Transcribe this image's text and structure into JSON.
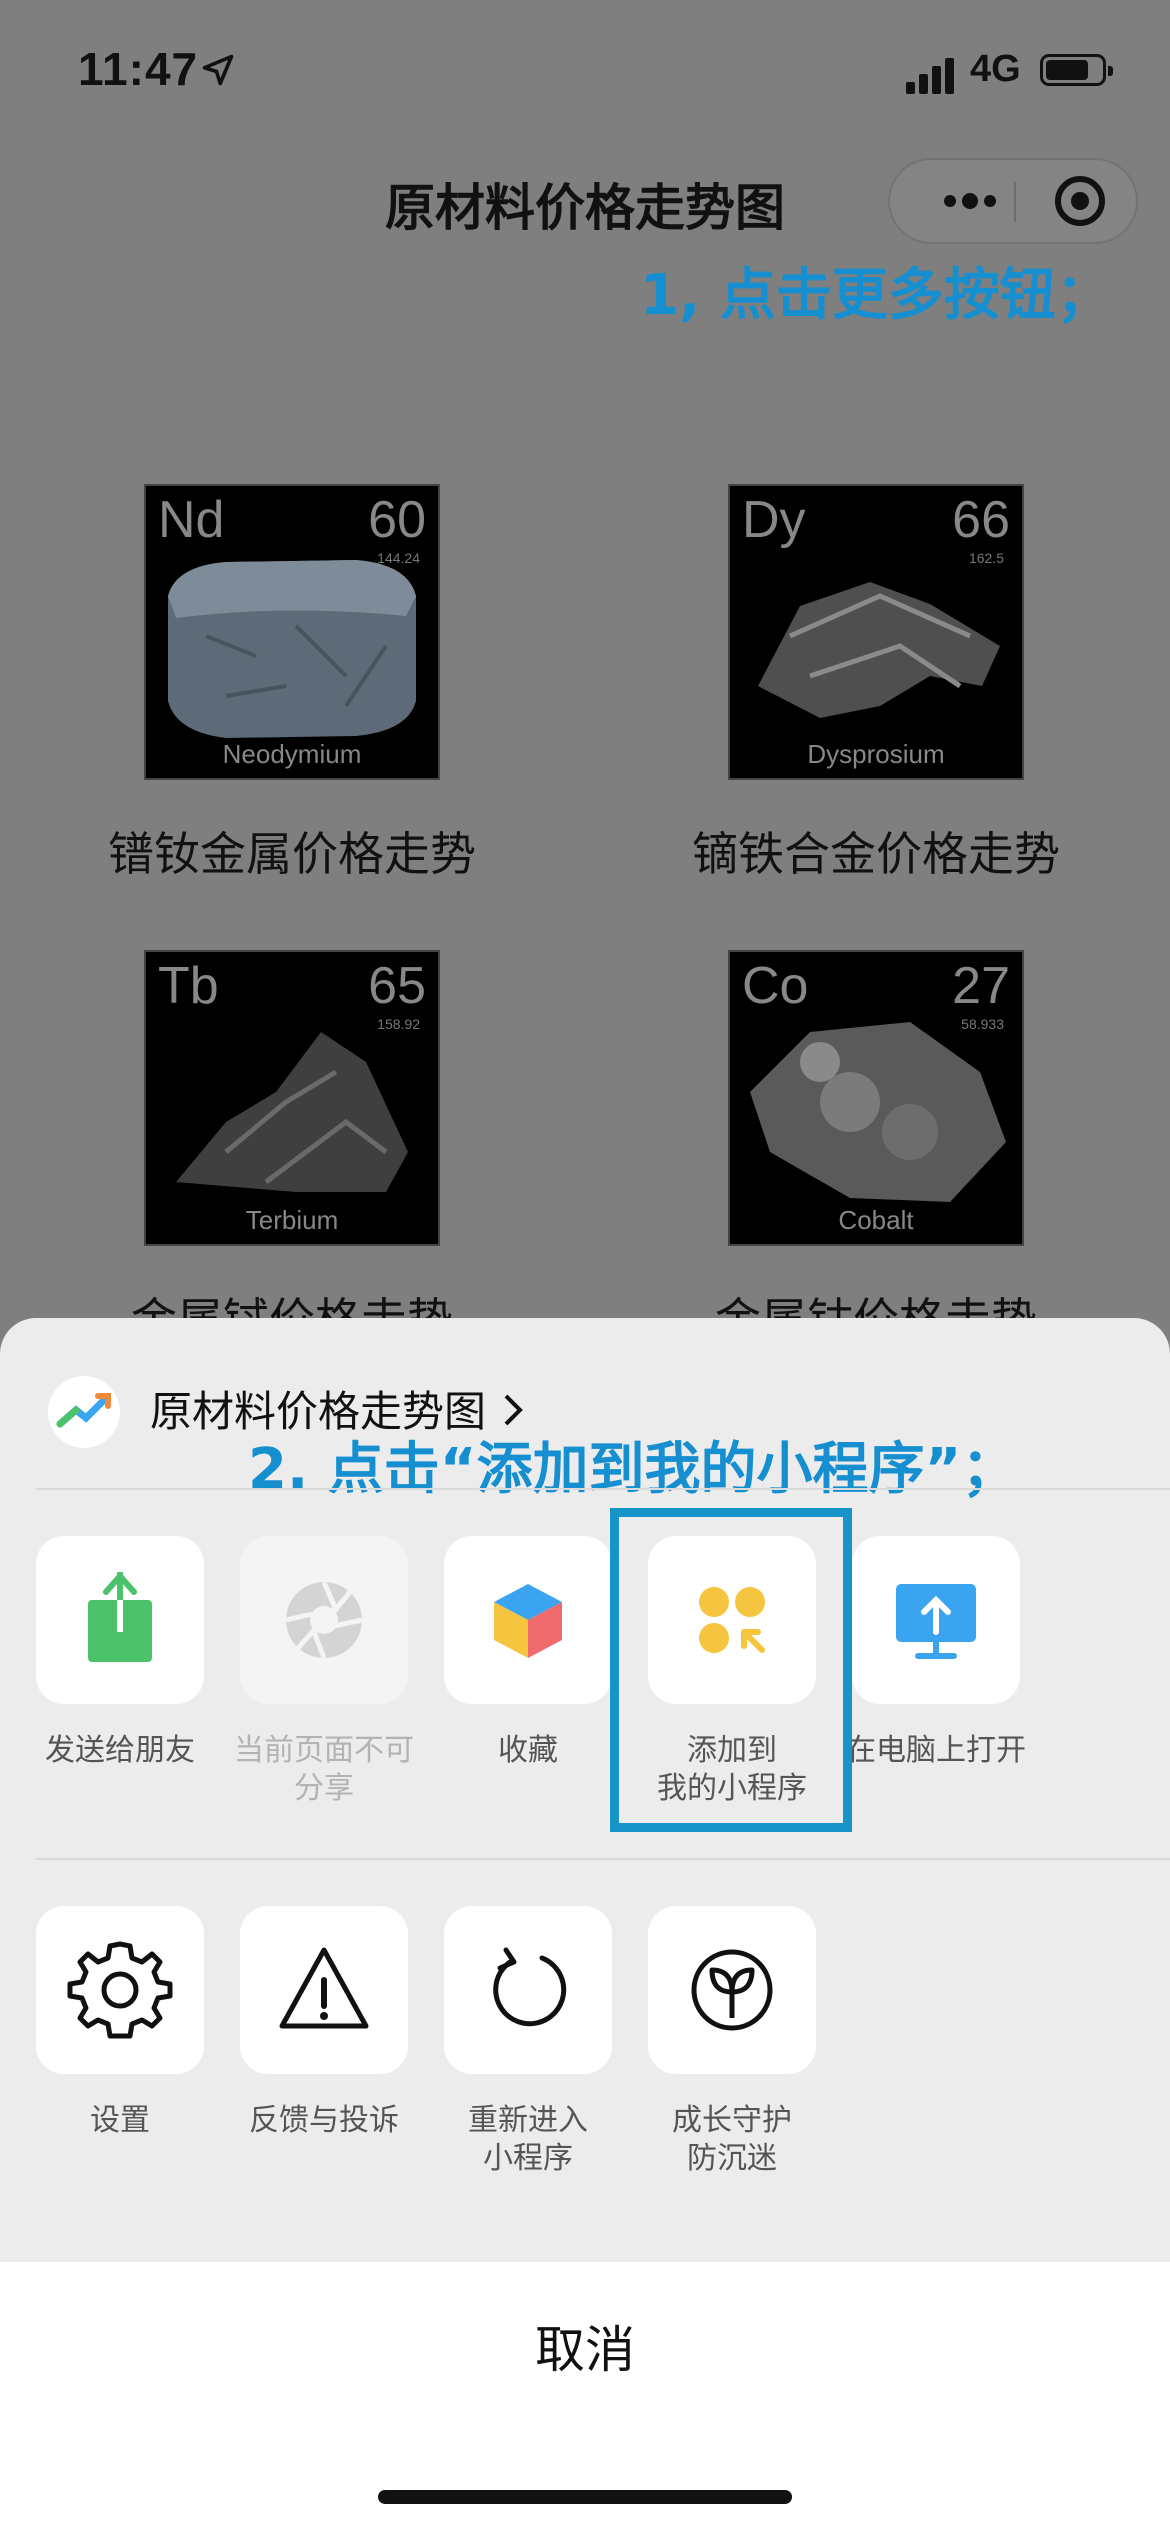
{
  "status": {
    "time": "11:47",
    "network": "4G"
  },
  "nav": {
    "title": "原材料价格走势图"
  },
  "hints": {
    "step1": "1, 点击更多按钮；",
    "step2": "2. 点击“添加到我的小程序”；"
  },
  "elements": [
    {
      "symbol": "Nd",
      "number": "60",
      "mass": "144.24",
      "name": "Neodymium",
      "label": "镨钕金属价格走势"
    },
    {
      "symbol": "Dy",
      "number": "66",
      "mass": "162.5",
      "name": "Dysprosium",
      "label": "镝铁合金价格走势"
    },
    {
      "symbol": "Tb",
      "number": "65",
      "mass": "158.92",
      "name": "Terbium",
      "label": "金属铽价格走势"
    },
    {
      "symbol": "Co",
      "number": "27",
      "mass": "58.933",
      "name": "Cobalt",
      "label": "金属钴价格走势"
    }
  ],
  "sheet": {
    "app_name": "原材料价格走势图",
    "row1": [
      {
        "label": "发送给朋友",
        "icon": "share-icon",
        "disabled": false
      },
      {
        "label": "当前页面不可分享",
        "icon": "aperture-icon",
        "disabled": true
      },
      {
        "label": "收藏",
        "icon": "cube-icon",
        "disabled": false
      },
      {
        "label": "添加到我的小程序",
        "icon": "add-miniprogram-icon",
        "disabled": false
      },
      {
        "label": "在电脑上打开",
        "icon": "monitor-icon",
        "disabled": false
      }
    ],
    "row2": [
      {
        "label": "设置",
        "icon": "gear-icon"
      },
      {
        "label": "反馈与投诉",
        "icon": "warning-icon"
      },
      {
        "label": "重新进入小程序",
        "icon": "reload-icon"
      },
      {
        "label": "成长守护防沉迷",
        "icon": "sprout-icon"
      }
    ],
    "cancel": "取消"
  },
  "colors": {
    "hint": "#168fd0",
    "highlight": "#1694c8",
    "share": "#4cc26a",
    "add": "#f6c53f",
    "monitor": "#3aa4f0"
  }
}
